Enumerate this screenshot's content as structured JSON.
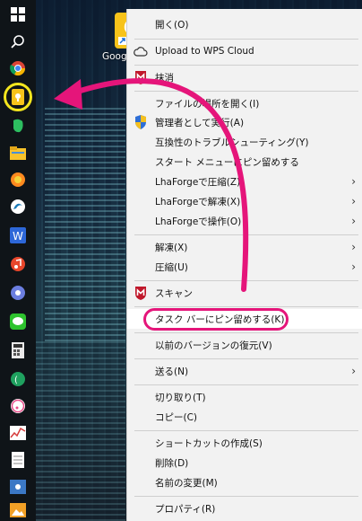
{
  "desktop": {
    "icon_label": "Google Keep"
  },
  "taskbar": {
    "icons": [
      "windows-icon",
      "search-icon",
      "chrome-icon",
      "google-keep-icon",
      "evernote-icon",
      "file-explorer-icon",
      "firefox-icon",
      "edge-icon",
      "wps-writer-icon",
      "music-icon",
      "media-player-icon",
      "line-icon",
      "calculator-icon",
      "wps-pdf-icon",
      "itunes-icon",
      "task-manager-icon",
      "notepad-icon",
      "settings-icon",
      "photos-icon"
    ]
  },
  "menu": {
    "open": "開く(O)",
    "upload_wps": "Upload to WPS Cloud",
    "erase": "抹消",
    "open_location": "ファイルの場所を開く(I)",
    "run_as_admin": "管理者として実行(A)",
    "troubleshoot": "互換性のトラブルシューティング(Y)",
    "pin_start": "スタート メニューにピン留めする",
    "lhaforge_compress": "LhaForgeで圧縮(Z)",
    "lhaforge_extract": "LhaForgeで解凍(X)",
    "lhaforge_operate": "LhaForgeで操作(O)",
    "extract": "解凍(X)",
    "compress": "圧縮(U)",
    "scan": "スキャン",
    "pin_taskbar": "タスク バーにピン留めする(K)",
    "restore_version": "以前のバージョンの復元(V)",
    "send_to": "送る(N)",
    "cut": "切り取り(T)",
    "copy": "コピー(C)",
    "create_shortcut": "ショートカットの作成(S)",
    "delete": "削除(D)",
    "rename": "名前の変更(M)",
    "properties": "プロパティ(R)",
    "arrow": "›"
  },
  "colors": {
    "annotation": "#e5157a",
    "highlight_ring": "#f4e61e",
    "mcafee_red": "#c0182b"
  }
}
